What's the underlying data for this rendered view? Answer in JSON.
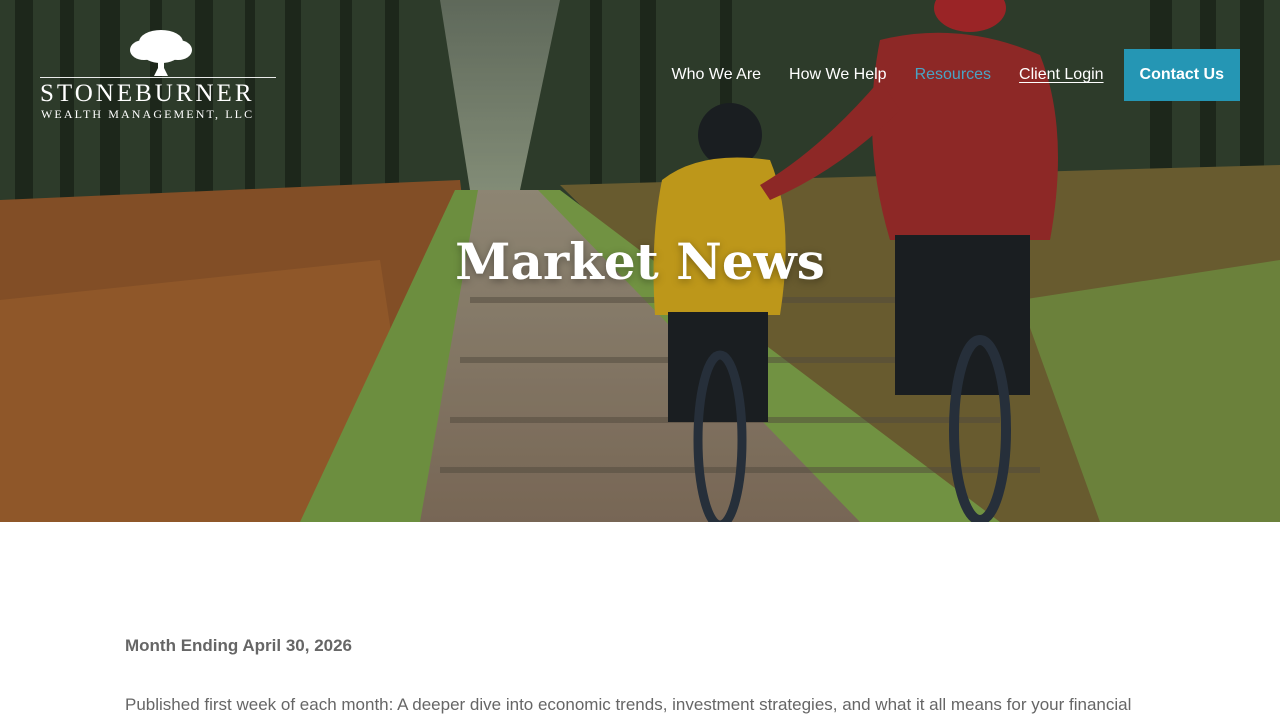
{
  "brand": {
    "name": "STONEBURNER",
    "subtitle": "WEALTH MANAGEMENT, LLC",
    "logo_icon": "oak-tree-icon"
  },
  "nav": {
    "items": [
      {
        "label": "Who We Are"
      },
      {
        "label": "How We Help"
      },
      {
        "label": "Resources"
      },
      {
        "label": "Client Login"
      }
    ],
    "cta_label": "Contact Us"
  },
  "hero": {
    "title": "Market News"
  },
  "article": {
    "period": "Month Ending April 30, 2026",
    "intro": "Published first week of each month: A deeper dive into economic trends, investment strategies, and what it all means for your financial"
  },
  "colors": {
    "accent": "#2596b4",
    "active_link": "#4aa3c4",
    "body_text": "#666666"
  }
}
